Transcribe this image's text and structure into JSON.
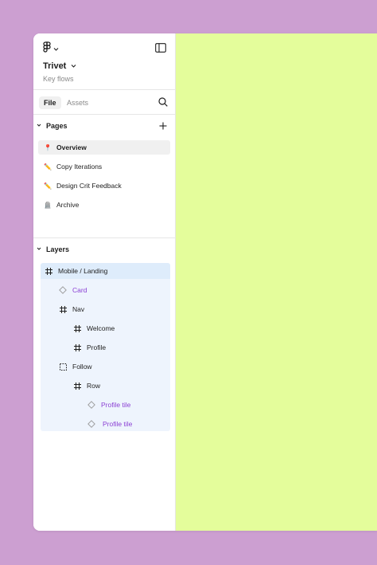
{
  "colors": {
    "background": "#cc9fd1",
    "canvas": "#e4fd9b",
    "component_text": "#8b3fd4",
    "selection": "#deecfb"
  },
  "header": {
    "logo_icon": "figma-logo-icon",
    "menu_chevron": "chevron-down-icon",
    "panel_toggle_icon": "sidebar-panel-icon",
    "file_title": "Trivet",
    "file_subtitle": "Key flows"
  },
  "tabs": [
    {
      "label": "File",
      "active": true
    },
    {
      "label": "Assets",
      "active": false
    }
  ],
  "search_icon": "search-icon",
  "pages": {
    "title": "Pages",
    "add_icon": "plus-icon",
    "items": [
      {
        "emoji": "📍",
        "label": "Overview",
        "active": true
      },
      {
        "emoji": "✏️",
        "label": "Copy Iterations",
        "active": false
      },
      {
        "emoji": "✏️",
        "label": "Design Crit Feedback",
        "active": false
      },
      {
        "emoji": "🪦",
        "label": "Archive",
        "active": false
      }
    ]
  },
  "layers": {
    "title": "Layers",
    "items": [
      {
        "icon": "frame-icon",
        "label": "Mobile / Landing",
        "depth": 0,
        "selected": true
      },
      {
        "icon": "component-instance-icon",
        "label": "Card",
        "depth": 1
      },
      {
        "icon": "frame-icon",
        "label": "Nav",
        "depth": 1
      },
      {
        "icon": "frame-icon",
        "label": "Welcome",
        "depth": 2
      },
      {
        "icon": "frame-icon",
        "label": "Profile",
        "depth": 2
      },
      {
        "icon": "group-icon",
        "label": "Follow",
        "depth": 1
      },
      {
        "icon": "frame-icon",
        "label": "Row",
        "depth": 2
      },
      {
        "icon": "component-instance-icon",
        "label": "Profile tile",
        "depth": 3
      },
      {
        "icon": "component-instance-icon",
        "label": "Profile tile",
        "depth": 3
      }
    ]
  }
}
